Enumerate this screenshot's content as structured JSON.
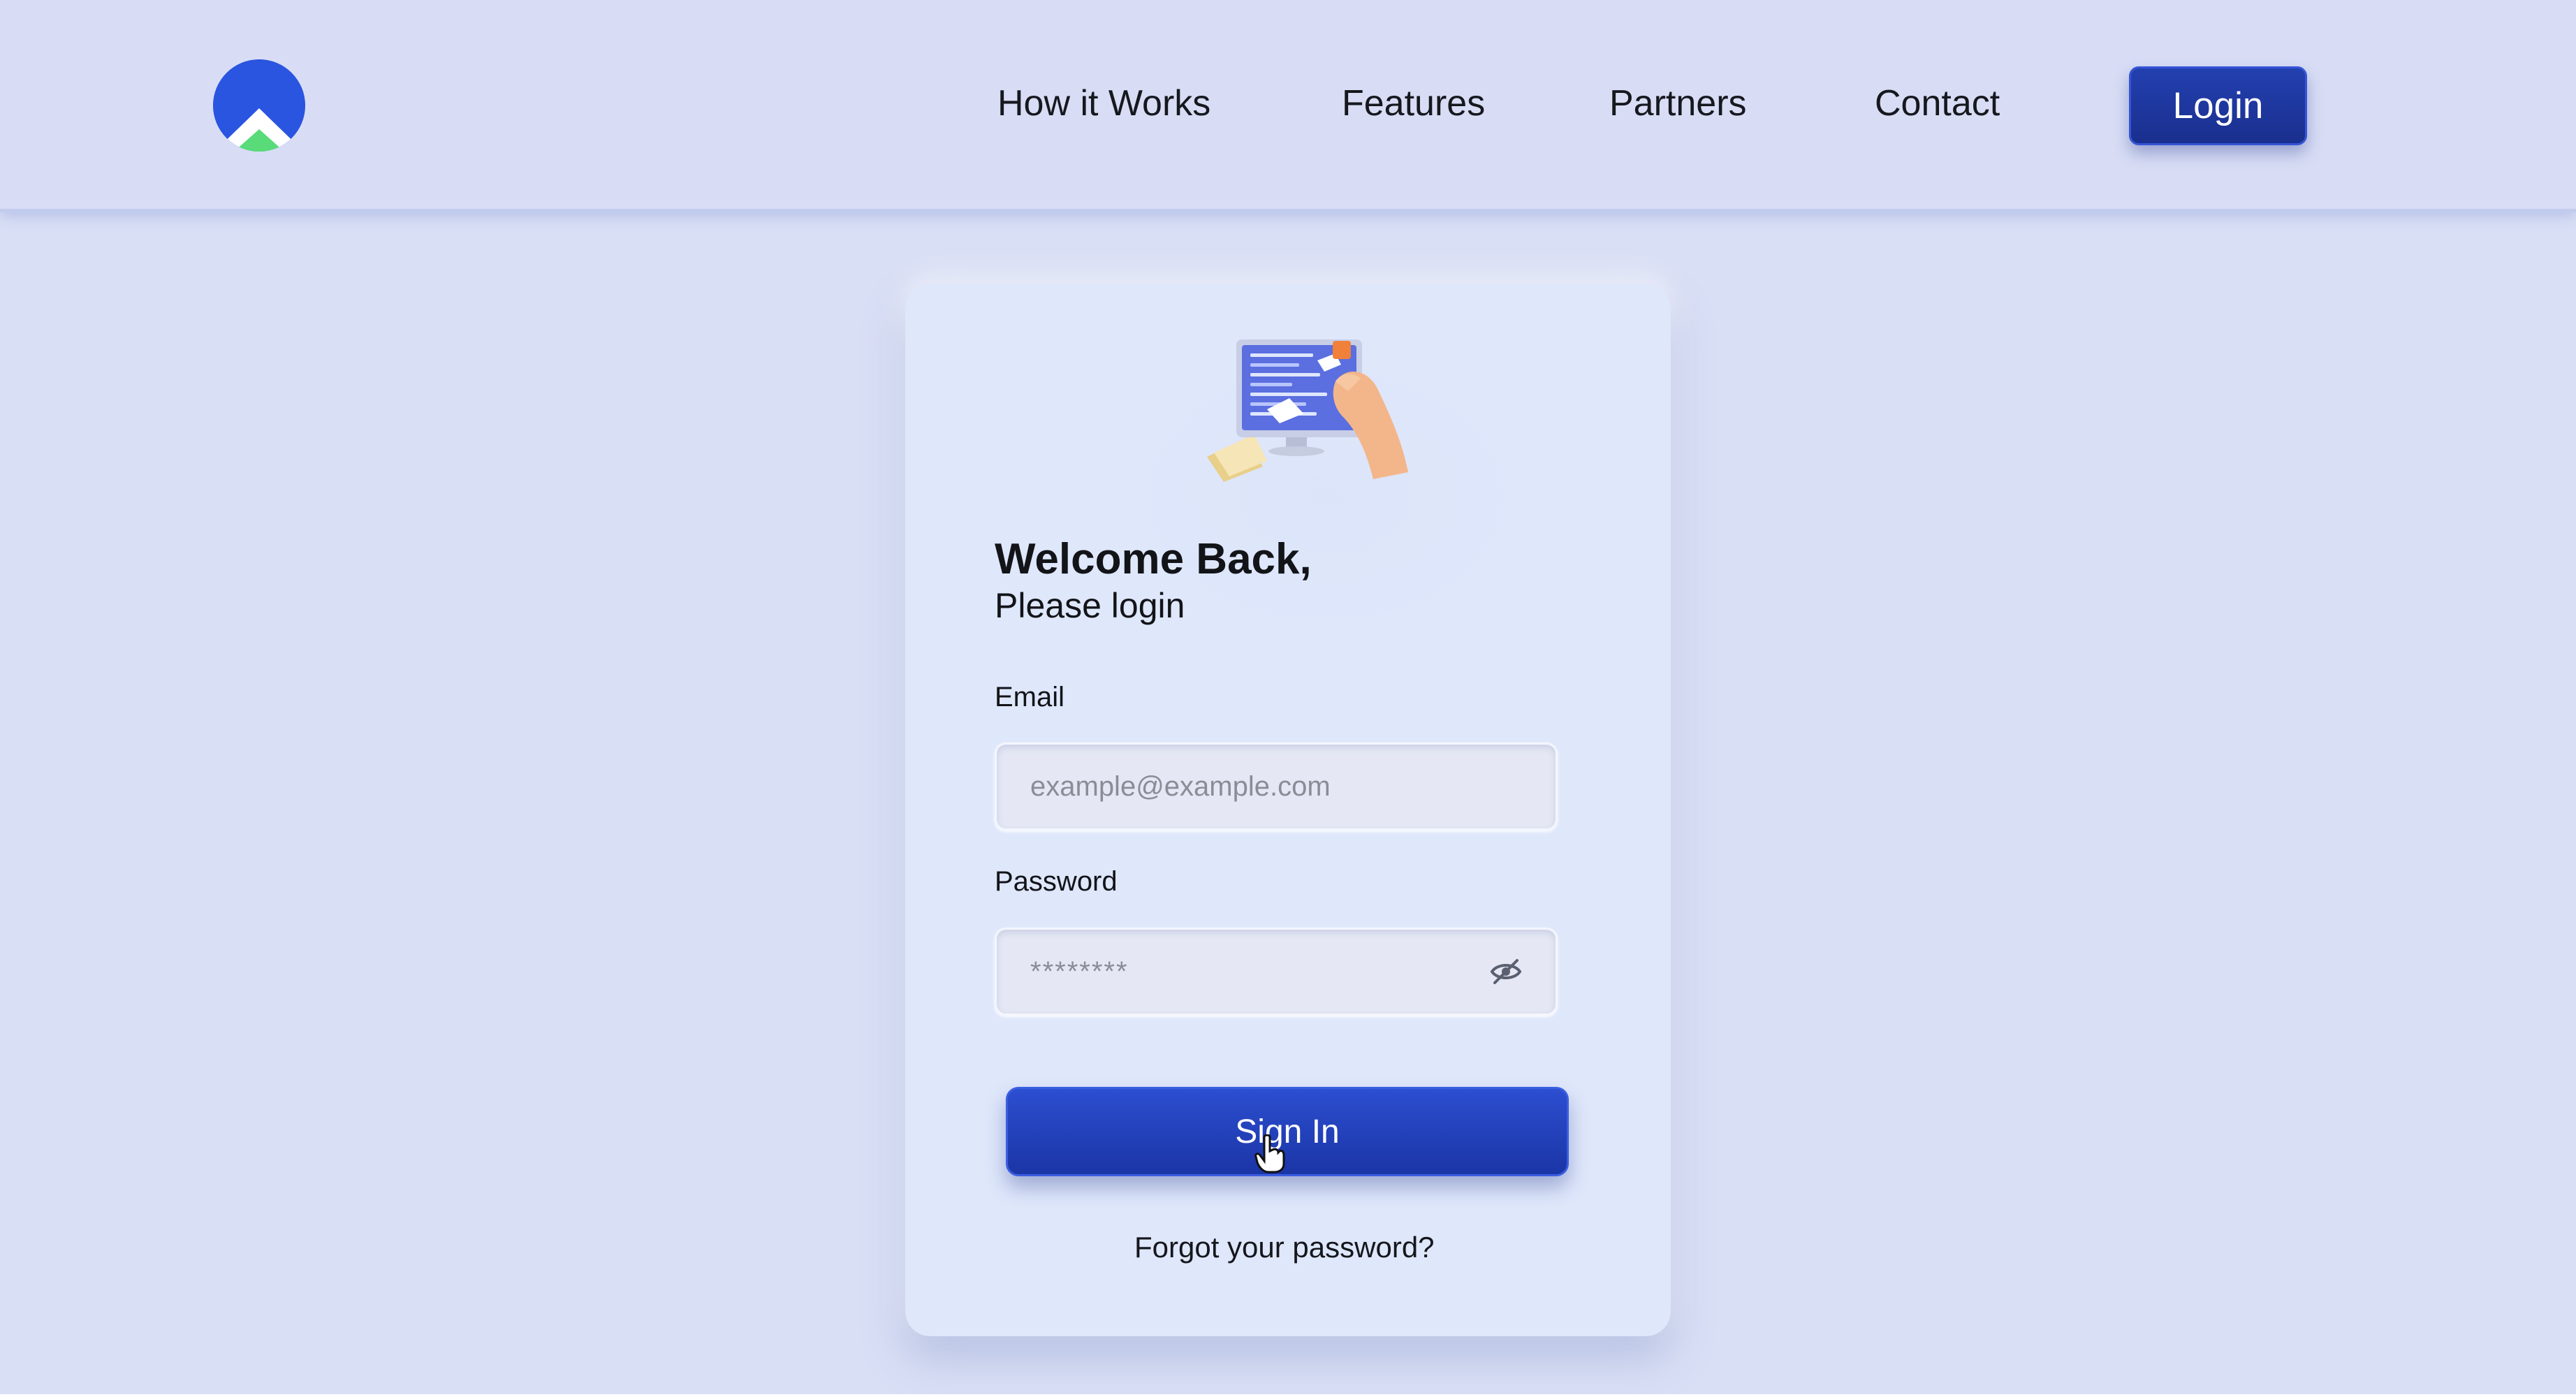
{
  "header": {
    "logo_icon": "mountain-sun-logo-icon",
    "nav": [
      {
        "label": "How it Works"
      },
      {
        "label": "Features"
      },
      {
        "label": "Partners"
      },
      {
        "label": "Contact"
      }
    ],
    "login_label": "Login"
  },
  "card": {
    "illustration_icon": "computer-with-hand-illustration",
    "welcome": "Welcome Back,",
    "subtitle": "Please login",
    "email": {
      "label": "Email",
      "placeholder": "example@example.com",
      "value": ""
    },
    "password": {
      "label": "Password",
      "placeholder": "********",
      "value": "",
      "toggle_icon": "eye-slash-icon"
    },
    "signin_label": "Sign In",
    "forgot_label": "Forgot your password?"
  },
  "colors": {
    "background": "#d9dff5",
    "card": "#dfe7fb",
    "primary": "#1f3ab0",
    "logo_blue": "#2a55e0",
    "logo_green": "#55d877"
  }
}
